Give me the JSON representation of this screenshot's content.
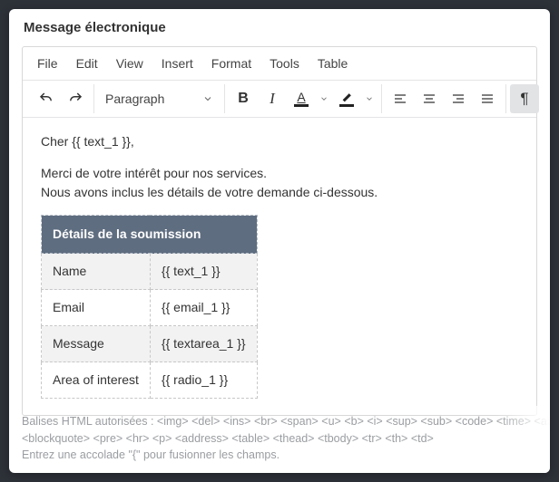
{
  "title": "Message électronique",
  "menu": {
    "file": "File",
    "edit": "Edit",
    "view": "View",
    "insert": "Insert",
    "format": "Format",
    "tools": "Tools",
    "table": "Table"
  },
  "toolbar": {
    "block_format": "Paragraph"
  },
  "body": {
    "greeting": "Cher {{ text_1 }},",
    "line1": "Merci de votre intérêt pour nos services.",
    "line2": "Nous avons inclus les détails de votre demande ci-dessous.",
    "table_header": "Détails de la soumission",
    "rows": [
      {
        "label": "Name",
        "value": "{{ text_1 }}"
      },
      {
        "label": "Email",
        "value": "{{ email_1 }}"
      },
      {
        "label": "Message",
        "value": "{{ textarea_1 }}"
      },
      {
        "label": "Area of interest",
        "value": "{{ radio_1 }}"
      }
    ]
  },
  "footer": {
    "allowed_label": "Balises HTML autorisées :",
    "allowed_tags": "<img> <del> <ins> <br> <span> <u> <b> <i> <sup> <sub> <code> <time> <ab",
    "allowed_tags2": "<blockquote> <pre> <hr> <p> <address> <table> <thead> <tbody> <tr> <th> <td>",
    "hint": "Entrez une accolade \"{\" pour fusionner les champs."
  }
}
